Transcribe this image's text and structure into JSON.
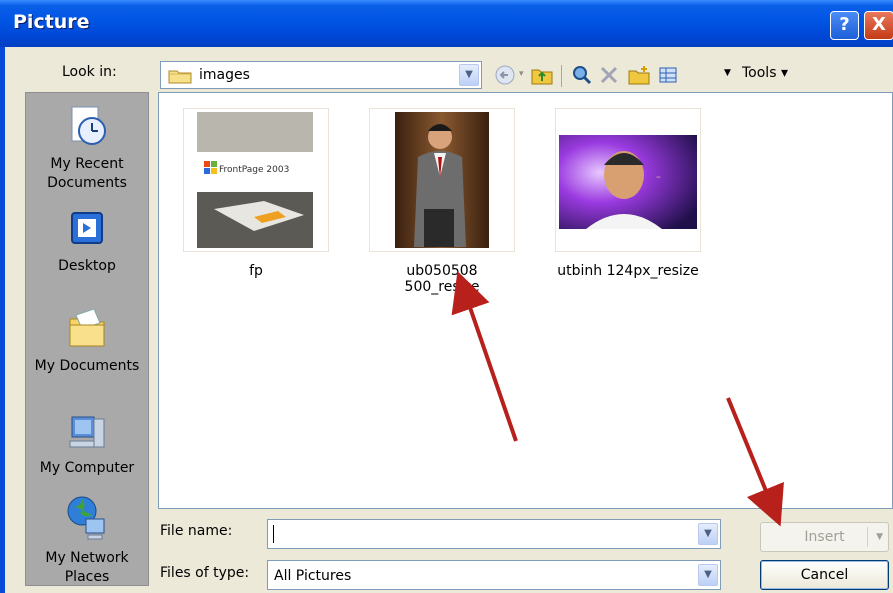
{
  "window": {
    "title": "Picture"
  },
  "title_buttons": {
    "help": "?",
    "close": "X"
  },
  "lookin": {
    "label": "Look in:",
    "value": "images"
  },
  "toolbar": {
    "tools_label": "Tools"
  },
  "places": [
    {
      "label": "My Recent Documents",
      "icon": "recent-documents-icon"
    },
    {
      "label": "Desktop",
      "icon": "desktop-icon"
    },
    {
      "label": "My Documents",
      "icon": "my-documents-icon"
    },
    {
      "label": "My Computer",
      "icon": "my-computer-icon"
    },
    {
      "label": "My Network Places",
      "icon": "network-places-icon"
    }
  ],
  "files": [
    {
      "name": "fp"
    },
    {
      "name": "ub050508 500_resize"
    },
    {
      "name": "utbinh 124px_resize"
    }
  ],
  "file_name": {
    "label": "File name:",
    "value": ""
  },
  "file_type": {
    "label": "Files of type:",
    "value": "All Pictures"
  },
  "buttons": {
    "insert": "Insert",
    "cancel": "Cancel"
  },
  "colors": {
    "titlebar": "#0054e3",
    "annotation_arrow": "#b8201b",
    "places_bar": "#a9a9a9"
  }
}
